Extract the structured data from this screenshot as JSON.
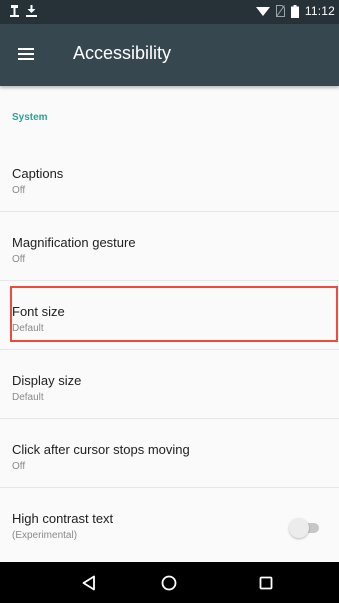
{
  "status_bar": {
    "time": "11:12",
    "left_icons": [
      "usb-icon",
      "download-icon"
    ],
    "right_icons": [
      "wifi-icon",
      "no-sim-icon",
      "battery-icon"
    ]
  },
  "app_bar": {
    "title": "Accessibility",
    "menu_icon": "hamburger-menu-icon"
  },
  "section": {
    "header": "System"
  },
  "items": [
    {
      "title": "Captions",
      "summary": "Off"
    },
    {
      "title": "Magnification gesture",
      "summary": "Off"
    },
    {
      "title": "Font size",
      "summary": "Default",
      "highlighted": true
    },
    {
      "title": "Display size",
      "summary": "Default"
    },
    {
      "title": "Click after cursor stops moving",
      "summary": "Off"
    },
    {
      "title": "High contrast text",
      "summary": "(Experimental)",
      "toggle": "off"
    }
  ],
  "nav_bar": {
    "icons": [
      "back-icon",
      "home-icon",
      "recents-icon"
    ]
  },
  "colors": {
    "status_bar": "#263238",
    "app_bar": "#37474f",
    "accent": "#26a69a",
    "highlight": "#f04a3a",
    "nav_bar": "#000000"
  }
}
